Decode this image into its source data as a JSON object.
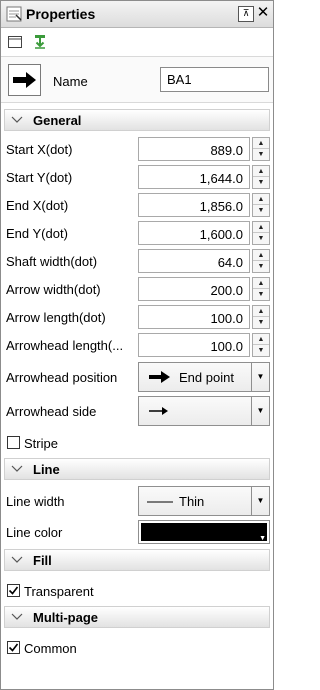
{
  "title": "Properties",
  "titlebar": {
    "pin_glyph": "⊼",
    "close_glyph": "✕"
  },
  "toolbar": {
    "icons": [
      "window-icon",
      "export-icon"
    ]
  },
  "name": {
    "label": "Name",
    "value": "BA1"
  },
  "sections": {
    "general": "General",
    "line": "Line",
    "fill": "Fill",
    "multipage": "Multi-page"
  },
  "general_fields": [
    {
      "label": "Start X(dot)",
      "value": "889.0"
    },
    {
      "label": "Start Y(dot)",
      "value": "1,644.0"
    },
    {
      "label": "End X(dot)",
      "value": "1,856.0"
    },
    {
      "label": "End Y(dot)",
      "value": "1,600.0"
    },
    {
      "label": "Shaft width(dot)",
      "value": "64.0"
    },
    {
      "label": "Arrow width(dot)",
      "value": "200.0"
    },
    {
      "label": "Arrow length(dot)",
      "value": "100.0"
    },
    {
      "label": "Arrowhead length(...",
      "value": "100.0"
    }
  ],
  "arrowhead_position": {
    "label": "Arrowhead position",
    "value": "End point"
  },
  "arrowhead_side": {
    "label": "Arrowhead side",
    "value": ""
  },
  "stripe": {
    "label": "Stripe",
    "checked": false
  },
  "line_width": {
    "label": "Line width",
    "value": "Thin"
  },
  "line_color": {
    "label": "Line color",
    "color": "#000000"
  },
  "transparent": {
    "label": "Transparent",
    "checked": true
  },
  "common": {
    "label": "Common",
    "checked": true
  },
  "colors": {
    "accent_green": "#3a9a3a",
    "border": "#8c8c8c"
  }
}
